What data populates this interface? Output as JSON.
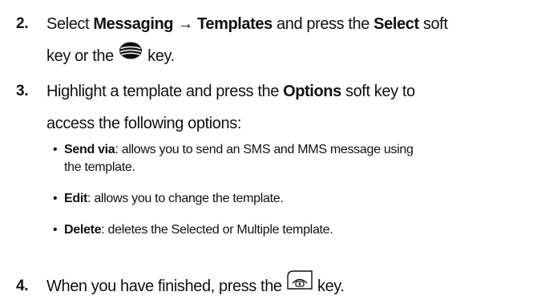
{
  "steps": [
    {
      "number": "2.",
      "prefix": "Select ",
      "path_bold": "Messaging → Templates",
      "mid": " and press the ",
      "select_bold": "Select",
      "after_select": " soft",
      "line2_prefix": "key or the ",
      "icon": "navigation-key-icon",
      "line2_suffix": " key."
    },
    {
      "number": "3.",
      "prefix": "Highlight a template and press the ",
      "options_bold": "Options",
      "suffix": " soft key to",
      "line2": "access the following options:"
    },
    {
      "number": "4.",
      "prefix": "When you have finished, press the ",
      "icon": "end-power-key-icon",
      "suffix": " key."
    }
  ],
  "options": [
    {
      "bullet": "•",
      "name": "Send via",
      "desc_line1": ": allows you to send an SMS and MMS message using",
      "desc_line2": "the template."
    },
    {
      "bullet": "•",
      "name": "Edit",
      "desc_line1": ": allows you to change the template."
    },
    {
      "bullet": "•",
      "name": "Delete",
      "desc_line1": ": deletes the Selected or Multiple template."
    }
  ]
}
